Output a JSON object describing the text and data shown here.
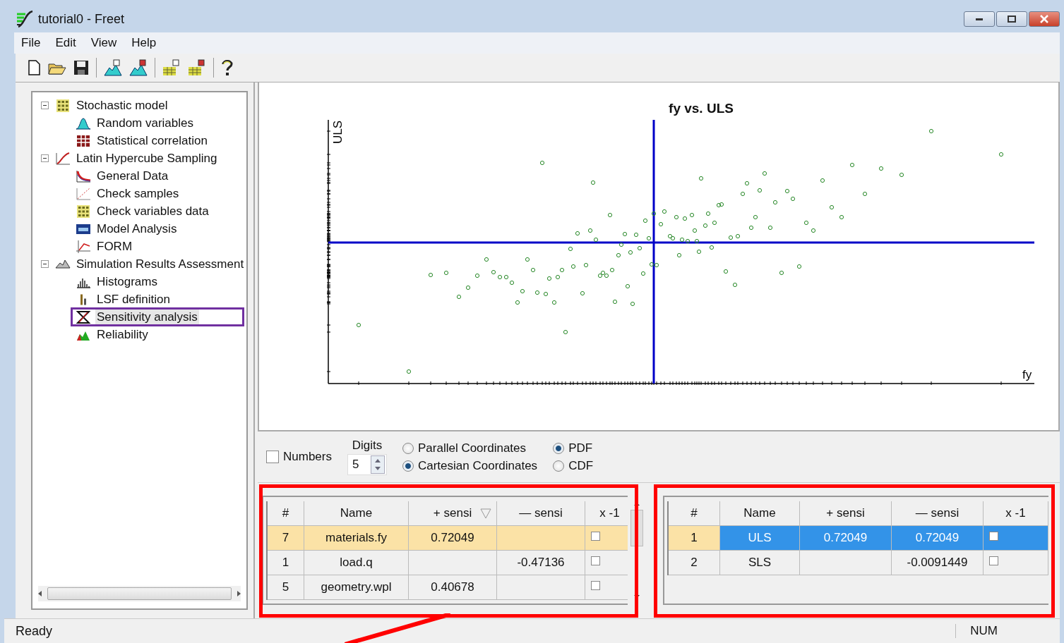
{
  "window": {
    "title": "tutorial0 - Freet"
  },
  "menu": [
    "File",
    "Edit",
    "View",
    "Help"
  ],
  "tree": [
    {
      "label": "Stochastic model",
      "expanded": true,
      "selected": false,
      "children": [
        {
          "label": "Random variables",
          "selected": false
        },
        {
          "label": "Statistical correlation",
          "selected": false
        }
      ]
    },
    {
      "label": "Latin Hypercube Sampling",
      "expanded": true,
      "selected": false,
      "children": [
        {
          "label": "General Data",
          "selected": false
        },
        {
          "label": "Check samples",
          "selected": false
        },
        {
          "label": "Check variables data",
          "selected": false
        },
        {
          "label": "Model Analysis",
          "selected": false
        },
        {
          "label": "FORM",
          "selected": false
        }
      ]
    },
    {
      "label": "Simulation Results Assessment",
      "expanded": true,
      "selected": false,
      "children": [
        {
          "label": "Histograms",
          "selected": false
        },
        {
          "label": "LSF definition",
          "selected": false
        },
        {
          "label": "Sensitivity analysis",
          "selected": true
        },
        {
          "label": "Reliability",
          "selected": false
        }
      ]
    }
  ],
  "chart": {
    "title": "fy vs. ULS",
    "ylabel": "ULS",
    "xlabel": "fy"
  },
  "options": {
    "numbers": {
      "label": "Numbers",
      "checked": false
    },
    "digits": {
      "label": "Digits",
      "value": "5"
    },
    "plot_type": [
      {
        "label": "Parallel Coordinates",
        "selected": false
      },
      {
        "label": "Cartesian Coordinates",
        "selected": true
      }
    ],
    "distribution": [
      {
        "label": "PDF",
        "selected": true
      },
      {
        "label": "CDF",
        "selected": false
      }
    ]
  },
  "variables_table": {
    "columns": [
      {
        "label": "#",
        "sorted": false
      },
      {
        "label": "Name",
        "sorted": false
      },
      {
        "label": "+ sensi",
        "sorted": true
      },
      {
        "label": "— sensi",
        "sorted": false
      },
      {
        "label": "x -1",
        "sorted": false
      }
    ],
    "rows": [
      {
        "cells": [
          "7",
          "materials.fy",
          "0.72049",
          ""
        ],
        "checked": false,
        "selected": true
      },
      {
        "cells": [
          "1",
          "load.q",
          "",
          "-0.47136"
        ],
        "checked": false,
        "selected": false
      },
      {
        "cells": [
          "5",
          "geometry.wpl",
          "0.40678",
          ""
        ],
        "checked": false,
        "selected": false
      }
    ]
  },
  "functions_table": {
    "columns": [
      {
        "label": "#",
        "sorted": false
      },
      {
        "label": "Name",
        "sorted": false
      },
      {
        "label": "+ sensi",
        "sorted": false
      },
      {
        "label": "— sensi",
        "sorted": false
      },
      {
        "label": "x -1",
        "sorted": false
      }
    ],
    "rows": [
      {
        "cells": [
          "1",
          "ULS",
          "0.72049",
          "0.72049"
        ],
        "checked": false,
        "selected": true
      },
      {
        "cells": [
          "2",
          "SLS",
          "",
          "-0.0091449"
        ],
        "checked": false,
        "selected": false
      }
    ]
  },
  "status_bar": {
    "message": "Ready",
    "indicator": "NUM"
  }
}
